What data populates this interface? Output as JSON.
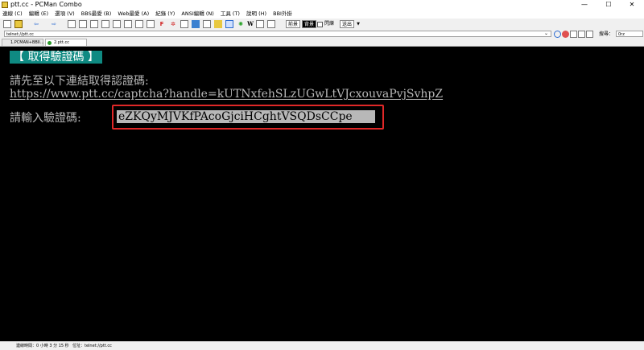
{
  "window": {
    "title": "ptt.cc - PCMan Combo",
    "minimize": "—",
    "maximize": "☐",
    "close": "✕"
  },
  "menu": [
    "連線 (C)",
    "編輯 (E)",
    "選項 (V)",
    "BBS最愛 (B)",
    "Web最愛 (A)",
    "紀錄 (Y)",
    "ANSI編輯 (N)",
    "工具 (T)",
    "說明 (H)",
    "BBI外掛"
  ],
  "toolbar": {
    "font_btn": "前景",
    "bg_btn": "背景",
    "blink_label": "閃爍",
    "exit_btn": "送出",
    "w_label": "W"
  },
  "address": {
    "value": "telnet://ptt.cc"
  },
  "search": {
    "label": "搜尋：",
    "value": "0rz"
  },
  "tabs": [
    {
      "label": "1.PCMAN+BBII...",
      "active": false
    },
    {
      "label": "2.ptt.cc",
      "active": true
    }
  ],
  "terminal": {
    "heading": "【  取得驗證碼  】",
    "instruction": "請先至以下連結取得認證碼:",
    "link": "https://www.ptt.cc/captcha?handle=kUTNxfehSLzUGwLtVJcxouvaPvjSvhpZ",
    "prompt": "請輸入驗證碼:",
    "code": "eZKQyMJVKfPAcoGjciHCghtVSQDsCCpe"
  },
  "status": {
    "time": "連線時間：0 小時 3 分 15 秒",
    "location": "位址：telnet://ptt.cc"
  },
  "colors": {
    "terminal_bg": "#000000",
    "heading_bg": "#0f8a82",
    "highlight_border": "#e02828",
    "input_bg": "#b8b8b8"
  }
}
